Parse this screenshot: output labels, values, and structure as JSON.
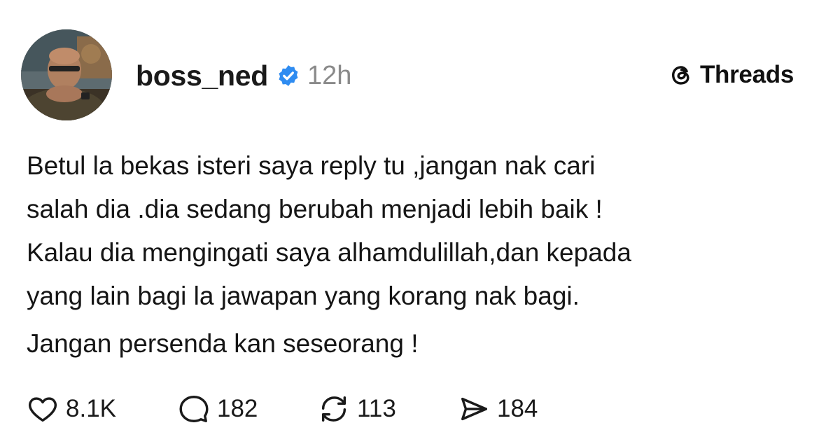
{
  "post": {
    "username": "boss_ned",
    "verified": true,
    "timestamp": "12h",
    "platform": "Threads",
    "body_lines": [
      "Betul la bekas isteri saya reply tu ,jangan nak cari",
      "salah dia .dia sedang berubah menjadi lebih baik !",
      "Kalau dia mengingati saya alhamdulillah,dan kepada",
      "yang lain bagi la jawapan yang korang nak bagi."
    ],
    "body_last_line": "Jangan persenda kan seseorang !",
    "stats": {
      "likes": "8.1K",
      "comments": "182",
      "reposts": "113",
      "shares": "184"
    },
    "colors": {
      "verified_badge": "#2f8cf1",
      "timestamp": "#8a8a8a",
      "text": "#151515"
    },
    "icons": {
      "verified": "verified-badge-icon",
      "brand": "threads-logo-icon",
      "like": "heart-icon",
      "comment": "speech-bubble-icon",
      "repost": "repost-arrows-icon",
      "share": "send-icon"
    }
  }
}
